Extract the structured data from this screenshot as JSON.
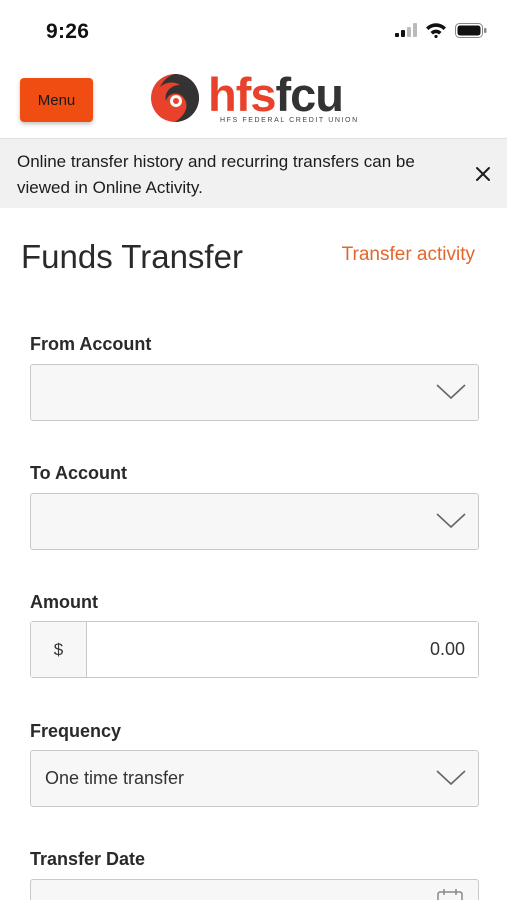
{
  "status_bar": {
    "time": "9:26"
  },
  "header": {
    "menu_label": "Menu",
    "logo": {
      "word_hfs": "hfs",
      "word_fcu": "fcu",
      "subtitle": "HFS FEDERAL CREDIT UNION"
    }
  },
  "notice": {
    "text": "Online transfer history and recurring transfers can be viewed in Online Activity."
  },
  "page": {
    "title": "Funds Transfer",
    "activity_link": "Transfer activity"
  },
  "form": {
    "from_account": {
      "label": "From Account",
      "value": ""
    },
    "to_account": {
      "label": "To Account",
      "value": ""
    },
    "amount": {
      "label": "Amount",
      "prefix": "$",
      "value": "0.00"
    },
    "frequency": {
      "label": "Frequency",
      "value": "One time transfer"
    },
    "transfer_date": {
      "label": "Transfer Date",
      "value": ""
    }
  },
  "colors": {
    "accent": "#f04d12",
    "link": "#e2672d",
    "logo_red": "#e8412c",
    "logo_dark": "#333333"
  },
  "icons": [
    "signal-icon",
    "wifi-icon",
    "battery-icon",
    "close-icon",
    "chevron-down-icon",
    "calendar-icon"
  ]
}
